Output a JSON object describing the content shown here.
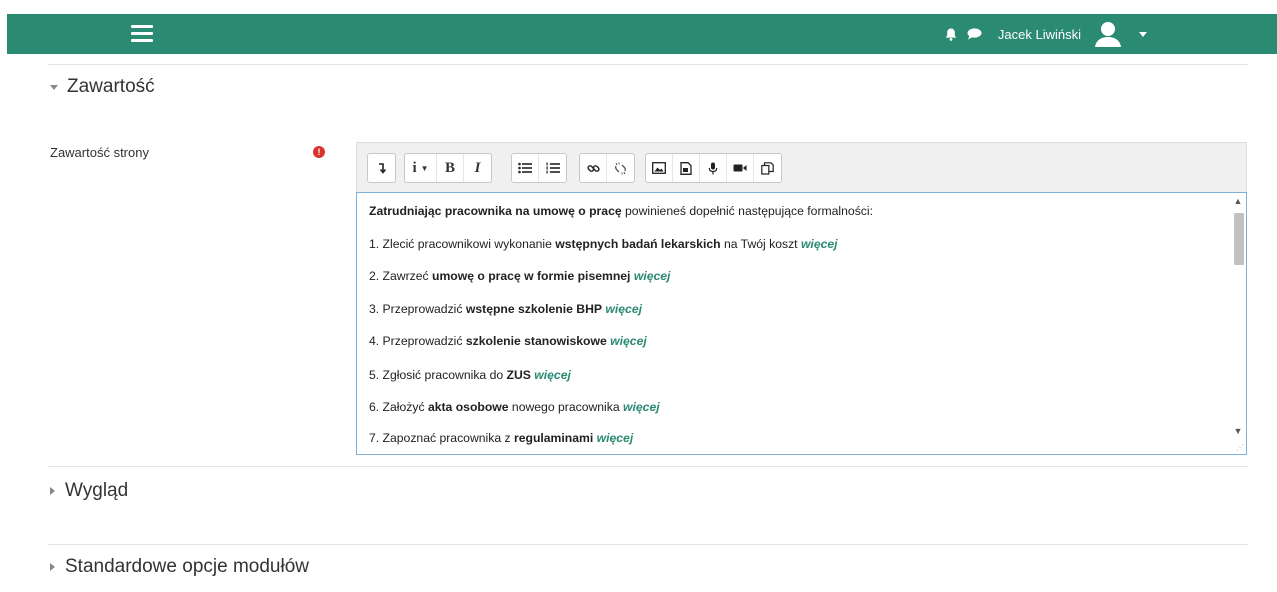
{
  "navbar": {
    "user_name": "Jacek Liwiński",
    "menu_icon": "hamburger-icon",
    "notification_icon": "bell-icon",
    "messages_icon": "chat-bubble-icon",
    "avatar_icon": "user-avatar-icon",
    "dropdown_icon": "caret-down-icon",
    "bg_color": "#2a8a72"
  },
  "sections": {
    "content": {
      "title": "Zawartość",
      "expanded": true
    },
    "appearance": {
      "title": "Wygląd",
      "expanded": false
    },
    "module_options": {
      "title": "Standardowe opcje modułów",
      "expanded": false
    }
  },
  "form": {
    "content_label": "Zawartość strony",
    "required_icon": "exclamation-circle-icon"
  },
  "toolbar": {
    "buttons": [
      "collapse-icon",
      "info-dropdown-icon",
      "bold-icon",
      "italic-icon",
      "unordered-list-icon",
      "ordered-list-icon",
      "link-icon",
      "unlink-icon",
      "image-icon",
      "media-icon",
      "record-audio-icon",
      "record-video-icon",
      "manage-files-icon"
    ],
    "bold_label": "B",
    "italic_label": "I",
    "info_label": "i"
  },
  "editor": {
    "intro": {
      "bold": "Zatrudniając pracownika na umowę o pracę",
      "rest": " powinieneś dopełnić następujące formalności:"
    },
    "more_label": "więcej",
    "items": [
      {
        "before": "1. Zlecić pracownikowi wykonanie ",
        "bold": "wstępnych badań lekarskich",
        "after": " na Twój koszt "
      },
      {
        "before": "2. Zawrzeć ",
        "bold": "umowę o pracę w formie pisemnej",
        "after": " "
      },
      {
        "before": "3. Przeprowadzić ",
        "bold": "wstępne szkolenie BHP",
        "after": " "
      },
      {
        "before": "4. Przeprowadzić ",
        "bold": "szkolenie stanowiskowe",
        "after": " "
      },
      {
        "before": "5. Zgłosić pracownika do ",
        "bold": "ZUS",
        "after": " "
      },
      {
        "before": "6. Założyć ",
        "bold": "akta osobowe",
        "after": " nowego pracownika "
      },
      {
        "before": "7. Zapoznać pracownika z ",
        "bold": "regulaminami",
        "after": " "
      }
    ]
  }
}
